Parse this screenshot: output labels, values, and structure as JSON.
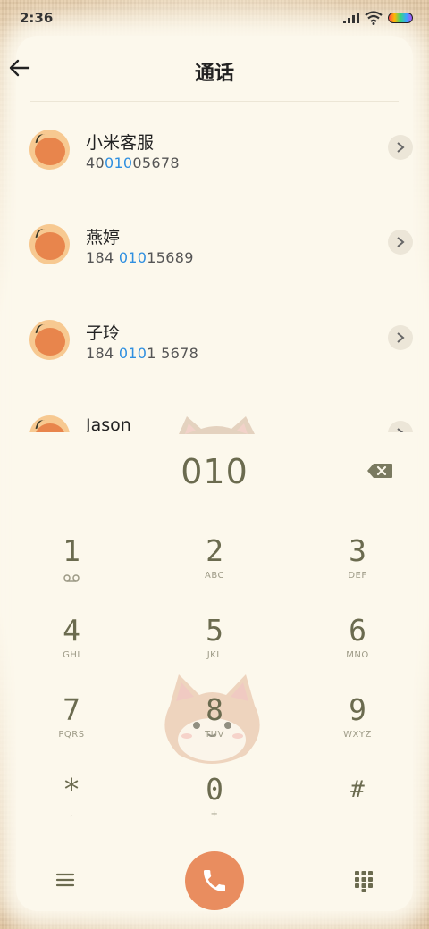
{
  "status_bar": {
    "time": "2:36"
  },
  "header": {
    "title": "通话"
  },
  "contacts": [
    {
      "name": "小米客服",
      "number_pre": "40",
      "number_hl": "010",
      "number_post": "05678"
    },
    {
      "name": "燕婷",
      "number_pre": "184 ",
      "number_hl": "010",
      "number_post": "15689"
    },
    {
      "name": "子玲",
      "number_pre": "184 ",
      "number_hl": "010",
      "number_post": "1 5678"
    },
    {
      "name": "Jason",
      "number_pre": "",
      "number_hl": "",
      "number_post": ""
    }
  ],
  "dial": {
    "number": "010"
  },
  "keypad": [
    {
      "digit": "1",
      "letters": ""
    },
    {
      "digit": "2",
      "letters": "ABC"
    },
    {
      "digit": "3",
      "letters": "DEF"
    },
    {
      "digit": "4",
      "letters": "GHI"
    },
    {
      "digit": "5",
      "letters": "JKL"
    },
    {
      "digit": "6",
      "letters": "MNO"
    },
    {
      "digit": "7",
      "letters": "PQRS"
    },
    {
      "digit": "8",
      "letters": "TUV"
    },
    {
      "digit": "9",
      "letters": "WXYZ"
    },
    {
      "digit": "*",
      "letters": ","
    },
    {
      "digit": "0",
      "letters": "+"
    },
    {
      "digit": "#",
      "letters": ""
    }
  ],
  "colors": {
    "accent": "#e98d5f",
    "highlight": "#2f8fe0",
    "digit": "#6b6b4f"
  },
  "icons": {
    "back": "arrow-left-icon",
    "delete": "backspace-icon",
    "voicemail": "voicemail-icon",
    "menu": "menu-icon",
    "call": "phone-icon",
    "dialpad": "dialpad-icon"
  }
}
